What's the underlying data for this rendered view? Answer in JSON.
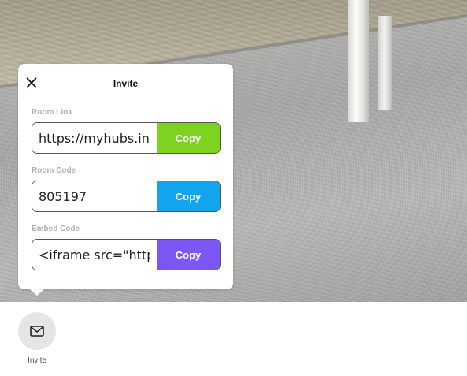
{
  "popover": {
    "title": "Invite",
    "fields": [
      {
        "label": "Room Link",
        "value": "https://myhubs.info/",
        "copy_label": "Copy",
        "copy_color": "#7ed321"
      },
      {
        "label": "Room Code",
        "value": "805197",
        "copy_label": "Copy",
        "copy_color": "#12a4ed"
      },
      {
        "label": "Embed Code",
        "value": "<iframe src=\"https://myhubs.info/",
        "copy_label": "Copy",
        "copy_color": "#7d57f5"
      }
    ]
  },
  "toolbar": {
    "invite_label": "Invite",
    "invite_icon": "envelope-icon"
  },
  "icons": {
    "close": "close-icon"
  }
}
